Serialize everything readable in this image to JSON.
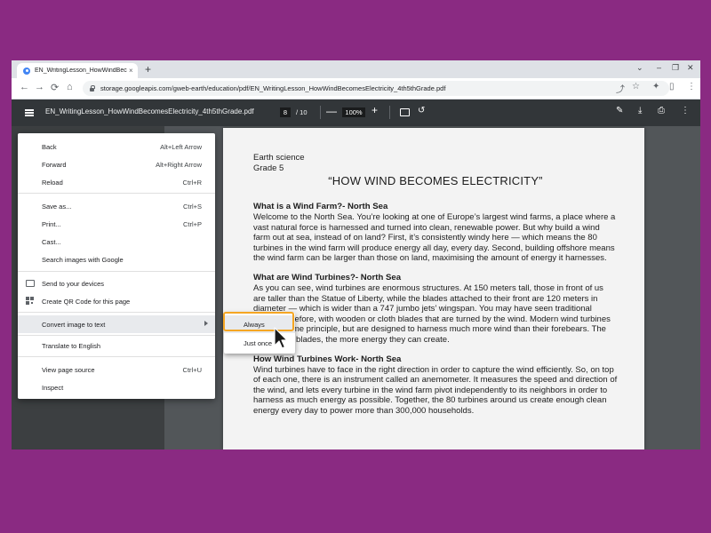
{
  "tab": {
    "title": "EN_WritingLesson_HowWindBec",
    "close": "×",
    "new": "+"
  },
  "window_controls": {
    "chevron": "⌄",
    "minimize": "–",
    "restore": "❐",
    "close": "✕"
  },
  "toolbar": {
    "back": "←",
    "forward": "→",
    "reload": "⟳",
    "home": "⌂",
    "url": "storage.googleapis.com/gweb-earth/education/pdf/EN_WritingLesson_HowWindBecomesElectricity_4th5thGrade.pdf",
    "share": "⤴",
    "star": "☆",
    "extensions": "✦",
    "sidepanel": "▯",
    "menu": "⋮"
  },
  "pdf_toolbar": {
    "menu_icon": "hamburger-icon",
    "filename": "EN_WritingLesson_HowWindBecomesElectricity_4th5thGrade.pdf",
    "page_current": "8",
    "page_total": "/ 10",
    "zoom_out": "—",
    "zoom": "100%",
    "zoom_in": "+",
    "rotate": "↺",
    "annotate": "✎",
    "download": "⤓",
    "print": "⎙",
    "more": "⋮"
  },
  "document": {
    "subject": "Earth science",
    "grade": "Grade 5",
    "title": "“HOW WIND BECOMES ELECTRICITY”",
    "sections": [
      {
        "heading": "What is a Wind Farm?- North Sea",
        "body": "Welcome to the North Sea. You’re looking at one of Europe’s largest wind farms, a place where a vast natural force is harnessed and turned into clean, renewable power. But why build a wind farm out at sea, instead of on land? First, it’s consistently windy here — which means the 80 turbines in the wind farm will produce energy all day, every day. Second, building offshore means the wind farm can be larger than those on land, maximising the amount of energy it harnesses."
      },
      {
        "heading": "What are Wind Turbines?- North Sea",
        "body": "As you can see, wind turbines are enormous structures. At 150 meters tall, those in front of us are taller than the Statue of Liberty, while the blades attached to their front are 120 meters in diameter — which is wider than a 747 jumbo jets’ wingspan. You may have seen traditional windmills before, with wooden or cloth blades that are turned by the wind. Modern wind turbines use the same principle, but are designed to harness much more wind than their forebears. The larger their blades, the more energy they can create."
      },
      {
        "heading": "How Wind Turbines Work- North Sea",
        "body": "Wind turbines have to face in the right direction in order to capture the wind efficiently. So, on top of each one, there is an instrument called an anemometer. It measures the speed and direction of the wind, and lets every turbine in the wind farm pivot independently to its neighbors in order to harness as much energy as possible. Together, the 80 turbines around us create enough clean energy every day to power more than 300,000 households."
      }
    ]
  },
  "context_menu": {
    "back": {
      "label": "Back",
      "shortcut": "Alt+Left Arrow"
    },
    "forward": {
      "label": "Forward",
      "shortcut": "Alt+Right Arrow"
    },
    "reload": {
      "label": "Reload",
      "shortcut": "Ctrl+R"
    },
    "save_as": {
      "label": "Save as...",
      "shortcut": "Ctrl+S"
    },
    "print": {
      "label": "Print...",
      "shortcut": "Ctrl+P"
    },
    "cast": {
      "label": "Cast..."
    },
    "search_images": {
      "label": "Search images with Google"
    },
    "send_devices": {
      "label": "Send to your devices"
    },
    "qr_code": {
      "label": "Create QR Code for this page"
    },
    "convert_image": {
      "label": "Convert image to text"
    },
    "translate": {
      "label": "Translate to English"
    },
    "view_source": {
      "label": "View page source",
      "shortcut": "Ctrl+U"
    },
    "inspect": {
      "label": "Inspect"
    }
  },
  "submenu": {
    "always": "Always",
    "just_once": "Just once"
  },
  "colors": {
    "highlight": "#f5a623",
    "background": "#8a2a82",
    "pdf_toolbar": "#323639"
  }
}
